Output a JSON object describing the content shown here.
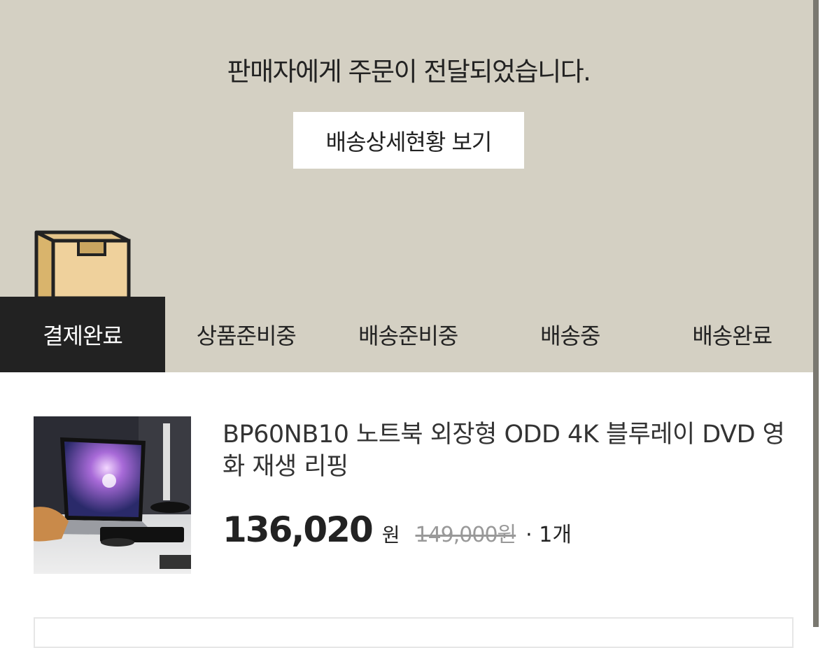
{
  "hero": {
    "message": "판매자에게 주문이 전달되었습니다.",
    "detail_button": "배송상세현황 보기",
    "bg_color": "#d4d0c3",
    "icon": "box-icon"
  },
  "tabs": [
    {
      "label": "결제완료",
      "active": true
    },
    {
      "label": "상품준비중",
      "active": false
    },
    {
      "label": "배송준비중",
      "active": false
    },
    {
      "label": "배송중",
      "active": false
    },
    {
      "label": "배송완료",
      "active": false
    }
  ],
  "product": {
    "name": "BP60NB10 노트북 외장형 ODD 4K 블루레이 DVD 영화 재생 리핑",
    "price": "136,020",
    "price_unit": "원",
    "original_price": "149,000원",
    "quantity": "· 1개"
  },
  "colors": {
    "accent_dark": "#222222",
    "muted": "#999999"
  }
}
